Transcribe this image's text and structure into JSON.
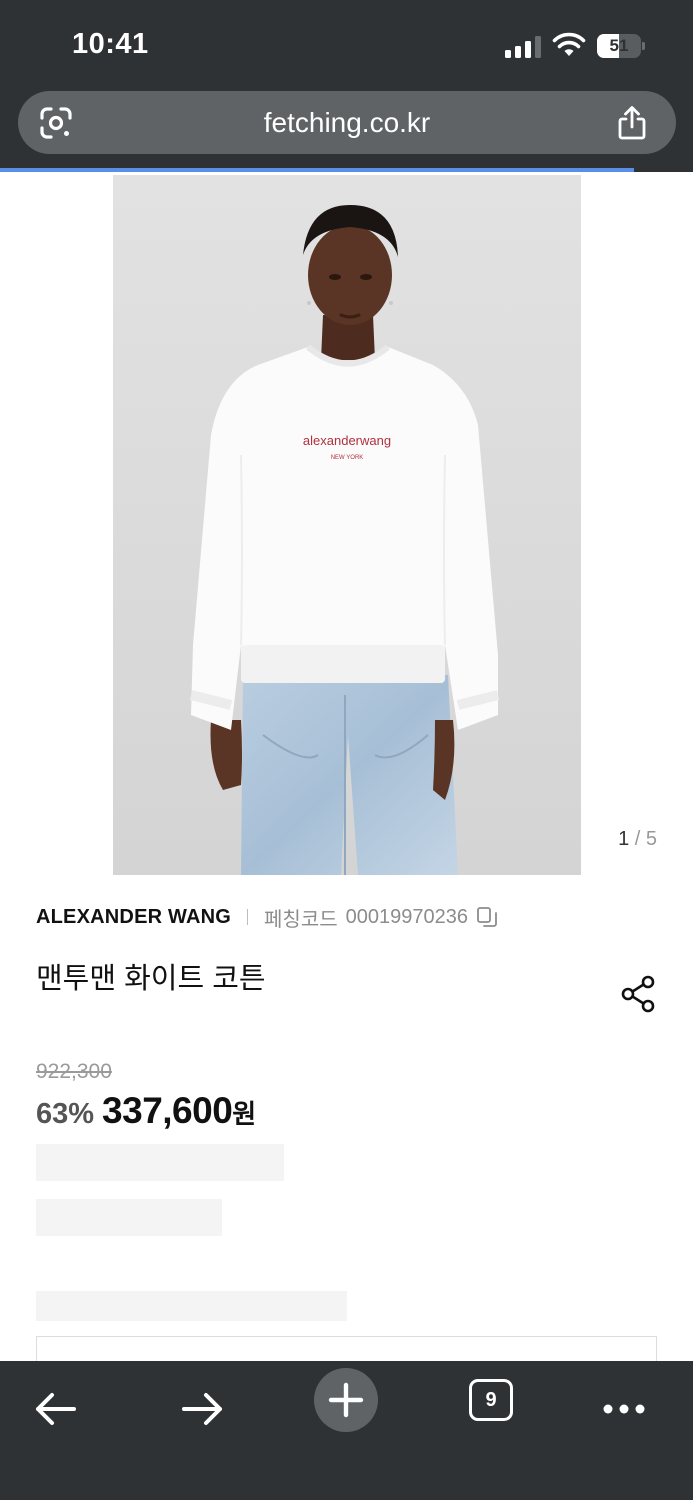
{
  "status_bar": {
    "time": "10:41",
    "battery": "51",
    "battery_level": 0.51
  },
  "browser": {
    "url": "fetching.co.kr",
    "load_progress": 0.915
  },
  "product": {
    "image_counter": {
      "current": "1",
      "separator": " / ",
      "total": "5"
    },
    "brand": "ALEXANDER WANG",
    "code_label": "페칭코드",
    "code": "00019970236",
    "title": "맨투맨 화이트 코튼",
    "original_price": "922,300",
    "discount": "63%",
    "price": "337,600",
    "currency": "원",
    "sweatshirt_print": "alexanderwang",
    "sweatshirt_subprint": "NEW YORK"
  },
  "toolbar": {
    "tab_count": "9"
  },
  "icons": {
    "lens": "google-lens-icon",
    "share_top": "share-icon",
    "copy": "copy-icon",
    "share_product": "share-nodes-icon",
    "back": "arrow-left-icon",
    "forward": "arrow-right-icon",
    "new_tab": "plus-icon",
    "tabs": "tabs-icon",
    "more": "more-dots-icon"
  },
  "colors": {
    "chrome": "#2f3234",
    "url_pill": "#5f6366",
    "progress": "#5b8ee6",
    "print": "#b0313f"
  }
}
